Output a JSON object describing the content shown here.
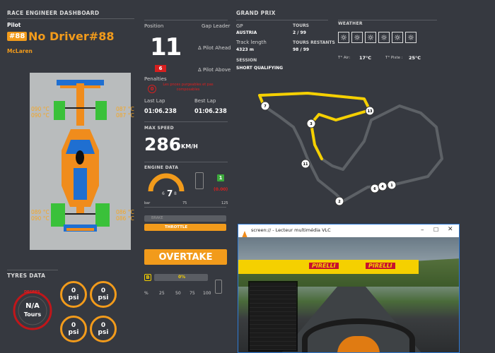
{
  "dashboard": {
    "title": "RACE ENGINEER DASHBOARD",
    "pilot_label": "Pilot",
    "pilot_number": "#88",
    "pilot_name": "No Driver#88",
    "team": "McLaren",
    "tyre_temps": {
      "fl": "090 °C\n090 °C",
      "fr": "087 °C\n087 °C",
      "rl": "089 °C\n090 °C",
      "rr": "086 °C\n086 °C"
    }
  },
  "tyres": {
    "title": "TYRES DATA",
    "wear_value": "N/A",
    "wear_unit": "Tours",
    "wear_arc_text": "DEGRES",
    "psi": [
      {
        "value": "0",
        "unit": "psi"
      },
      {
        "value": "0",
        "unit": "psi"
      },
      {
        "value": "0",
        "unit": "psi"
      },
      {
        "value": "0",
        "unit": "psi"
      }
    ]
  },
  "position": {
    "label": "Position",
    "value": "11",
    "badge": "6",
    "gap_leader": "Gap Leader",
    "pilot_ahead": "Δ Pilot Ahead",
    "pilot_above": "Δ Pilot Above",
    "penalties_label": "Penalties",
    "penalty_count": "0",
    "penalty_note": "Les pnces purgeables et pas composables",
    "last_lap_label": "Last Lap",
    "last_lap": "01:06.238",
    "best_lap_label": "Best Lap",
    "best_lap": "01:06.238"
  },
  "speed": {
    "title": "MAX SPEED",
    "value": "286",
    "unit": "KM/H"
  },
  "engine": {
    "title": "ENGINE DATA",
    "gear": "7",
    "gear_prev": "6",
    "gear_next": "8",
    "ers_count": "1",
    "ers_value": "(0.00)",
    "scale": [
      "bar",
      "75",
      "125"
    ],
    "brake_label": "BRAKE",
    "throttle_label": "THROTTLE",
    "overtake_label": "OVERTAKE",
    "fuel_badge": "B",
    "fuel_percent": "0%",
    "fuel_fraction": 0,
    "scale2": [
      "%",
      "25",
      "50",
      "75",
      "100"
    ]
  },
  "grandprix": {
    "title": "GRAND PRIX",
    "gp_label": "GP",
    "gp_value": "AUSTRIA",
    "tours_label": "TOURS",
    "tours_value": "2 / 99",
    "track_length_label": "Track length",
    "track_length_value": "4323 m",
    "tours_restants_label": "TOURS RESTANTS",
    "tours_restants_value": "98 / 99",
    "session_label": "SESSION",
    "session_value": "SHORT QUALIFYING"
  },
  "weather": {
    "title": "WEATHER",
    "icons": [
      "sun-icon",
      "sun-icon",
      "sun-icon",
      "sun-icon",
      "sun-icon",
      "sun-icon"
    ],
    "air_label": "T° Air:",
    "air_value": "17°C",
    "track_label": "T° Piste :",
    "track_value": "25°C"
  },
  "map": {
    "markers": [
      "7",
      "13",
      "3",
      "11",
      "2",
      "6",
      "4",
      "1"
    ]
  },
  "vlc": {
    "title": "screen:// - Lecteur multimédia VLC",
    "banner1": "PIRELLI",
    "banner2": "PIRELLI"
  }
}
